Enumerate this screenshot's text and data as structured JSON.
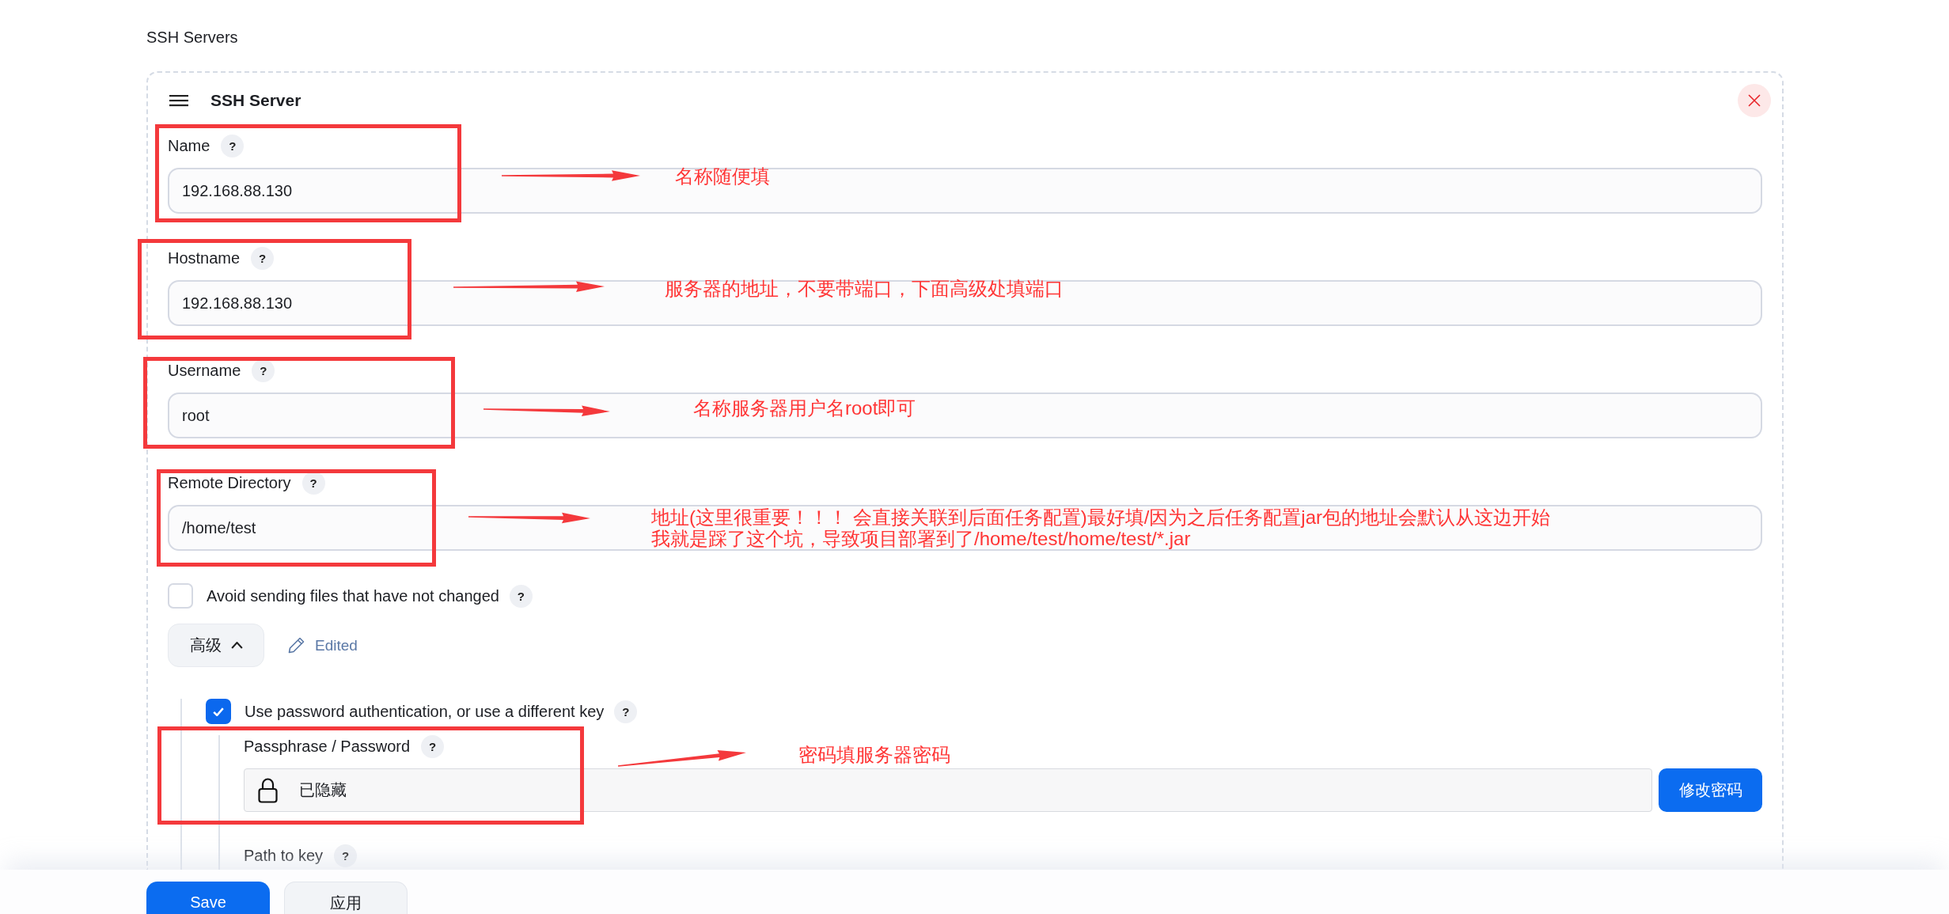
{
  "section_title": "SSH Servers",
  "server": {
    "title": "SSH Server",
    "fields": [
      {
        "label": "Name",
        "help": "?",
        "value": "192.168.88.130"
      },
      {
        "label": "Hostname",
        "help": "?",
        "value": "192.168.88.130"
      },
      {
        "label": "Username",
        "help": "?",
        "value": "root"
      },
      {
        "label": "Remote Directory",
        "help": "?",
        "value": "/home/test"
      }
    ],
    "avoid_unchanged": {
      "label": "Avoid sending files that have not changed",
      "help": "?",
      "checked": false
    },
    "advanced": {
      "label": "高级",
      "expanded": true,
      "note": "Edited"
    },
    "password_auth": {
      "label": "Use password authentication, or use a different key",
      "help": "?",
      "checked": true
    },
    "passphrase": {
      "label": "Passphrase / Password",
      "help": "?",
      "value": "已隐藏",
      "button": "修改密码"
    },
    "path_to_key": {
      "label": "Path to key",
      "help": "?"
    }
  },
  "buttons": [
    {
      "label": "Save",
      "kind": "primary"
    },
    {
      "label": "应用",
      "kind": "secondary"
    }
  ],
  "annotations": [
    {
      "lines": [
        "名称随便填"
      ]
    },
    {
      "lines": [
        "服务器的地址，不要带端口，下面高级处填端口"
      ]
    },
    {
      "lines": [
        "名称服务器用户名root即可"
      ]
    },
    {
      "lines": [
        "地址(这里很重要！！！ 会直接关联到后面任务配置)最好填/因为之后任务配置jar包的地址会默认从这边开始",
        "我就是踩了这个坑，导致项目部署到了/home/test/home/test/*.jar"
      ]
    },
    {
      "lines": [
        "密码填服务器密码"
      ]
    }
  ]
}
